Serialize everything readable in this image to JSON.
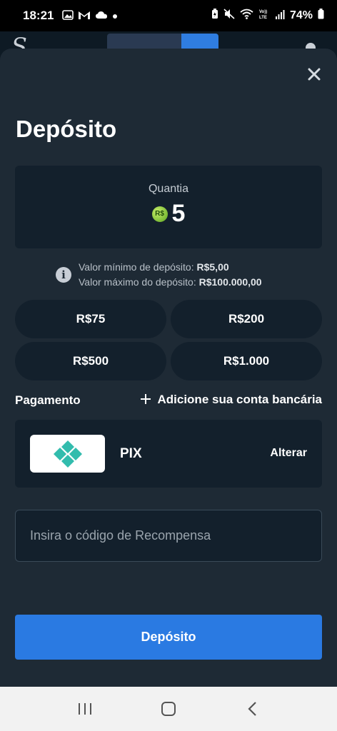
{
  "status_bar": {
    "time": "18:21",
    "battery": "74%",
    "left_icons": [
      "gallery-icon",
      "gmail-icon",
      "cloud-icon",
      "dot-icon"
    ],
    "right_icons": [
      "battery-saver-icon",
      "mute-icon",
      "wifi-icon",
      "volte-icon",
      "signal-icon",
      "battery-icon"
    ]
  },
  "modal": {
    "close_icon": "close-icon",
    "title": "Depósito",
    "amount": {
      "label": "Quantia",
      "currency_badge": "R$",
      "value": "5"
    },
    "limits": {
      "min_label": "Valor mínimo de depósito:",
      "min_value": "R$5,00",
      "max_label": "Valor máximo do depósito:",
      "max_value": "R$100.000,00"
    },
    "presets": [
      "R$75",
      "R$200",
      "R$500",
      "R$1.000"
    ],
    "payment": {
      "label": "Pagamento",
      "add_bank_label": "Adicione sua conta bancária",
      "method_name": "PIX",
      "change_label": "Alterar"
    },
    "reward_input": {
      "placeholder": "Insira o código de Recompensa",
      "value": ""
    },
    "submit_label": "Depósito"
  },
  "colors": {
    "accent": "#2a7ae2",
    "pix_teal": "#32bcad",
    "modal_bg": "#1e2a35",
    "card_bg": "#13202c"
  },
  "nav_bar": {
    "icons": [
      "recent-apps-icon",
      "home-icon",
      "back-icon"
    ]
  }
}
